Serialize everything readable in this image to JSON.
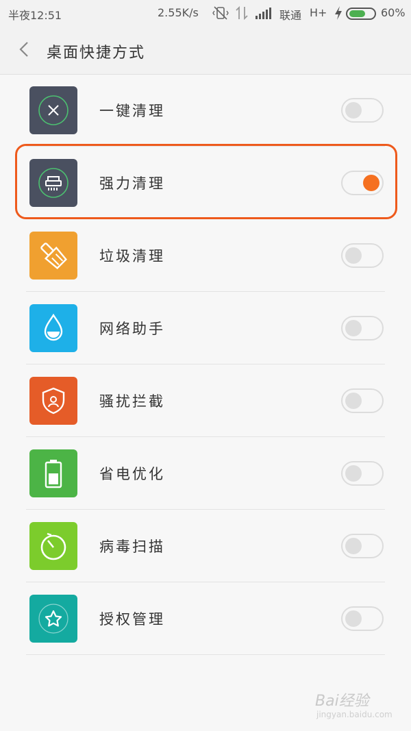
{
  "status_bar": {
    "time": "半夜12:51",
    "speed": "2.55K/s",
    "carrier": "联通",
    "network": "H+",
    "battery_percent": "60%",
    "battery_level": 0.6
  },
  "header": {
    "title": "桌面快捷方式",
    "back_icon": "chevron-left-icon"
  },
  "items": [
    {
      "label": "一键清理",
      "icon": "close-circle-icon",
      "color": "#4a5060",
      "enabled": false
    },
    {
      "label": "强力清理",
      "icon": "shredder-icon",
      "color": "#4a5060",
      "enabled": true
    },
    {
      "label": "垃圾清理",
      "icon": "broom-icon",
      "color": "#f0a030",
      "enabled": false
    },
    {
      "label": "网络助手",
      "icon": "water-drop-icon",
      "color": "#1eb0e8",
      "enabled": false
    },
    {
      "label": "骚扰拦截",
      "icon": "shield-user-icon",
      "color": "#e55c28",
      "enabled": false
    },
    {
      "label": "省电优化",
      "icon": "battery-icon",
      "color": "#4cb446",
      "enabled": false
    },
    {
      "label": "病毒扫描",
      "icon": "scan-circle-icon",
      "color": "#7ccc2c",
      "enabled": false
    },
    {
      "label": "授权管理",
      "icon": "star-circle-icon",
      "color": "#14aaa0",
      "enabled": false
    }
  ],
  "accent_color": "#f57020",
  "highlight_color": "#ee5a1c",
  "watermark": {
    "brand": "Bai经验",
    "url": "jingyan.baidu.com"
  }
}
